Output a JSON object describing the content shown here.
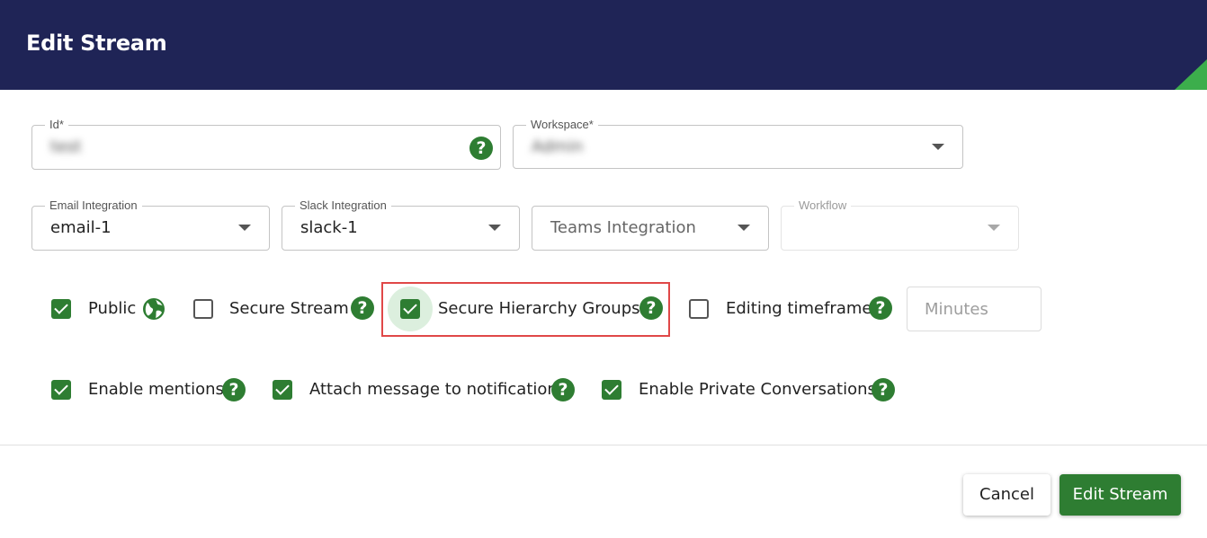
{
  "header": {
    "title": "Edit Stream"
  },
  "fields": {
    "id": {
      "label": "Id*",
      "value": "test"
    },
    "workspace": {
      "label": "Workspace*",
      "value": "Admin"
    },
    "email_integration": {
      "label": "Email Integration",
      "value": "email-1"
    },
    "slack_integration": {
      "label": "Slack Integration",
      "value": "slack-1"
    },
    "teams_integration": {
      "placeholder": "Teams Integration"
    },
    "workflow": {
      "label": "Workflow",
      "value": ""
    }
  },
  "options_row1": {
    "public": {
      "label": "Public",
      "checked": true,
      "icon": "globe-icon"
    },
    "secure_stream": {
      "label": "Secure Stream",
      "checked": false
    },
    "secure_hierarchy_groups": {
      "label": "Secure Hierarchy Groups",
      "checked": true
    },
    "editing_timeframe": {
      "label": "Editing timeframe",
      "checked": false
    },
    "minutes": {
      "placeholder": "Minutes"
    }
  },
  "options_row2": {
    "enable_mentions": {
      "label": "Enable mentions",
      "checked": true
    },
    "attach_message": {
      "label": "Attach message to notification",
      "checked": true
    },
    "enable_private": {
      "label": "Enable Private Conversations",
      "checked": true
    }
  },
  "help_icon_glyph": "?",
  "footer": {
    "cancel_label": "Cancel",
    "submit_label": "Edit Stream"
  },
  "colors": {
    "header_bg": "#1f2456",
    "accent_green": "#2e7d32",
    "corner_green": "#3cae4c",
    "highlight_red": "#e04848"
  }
}
